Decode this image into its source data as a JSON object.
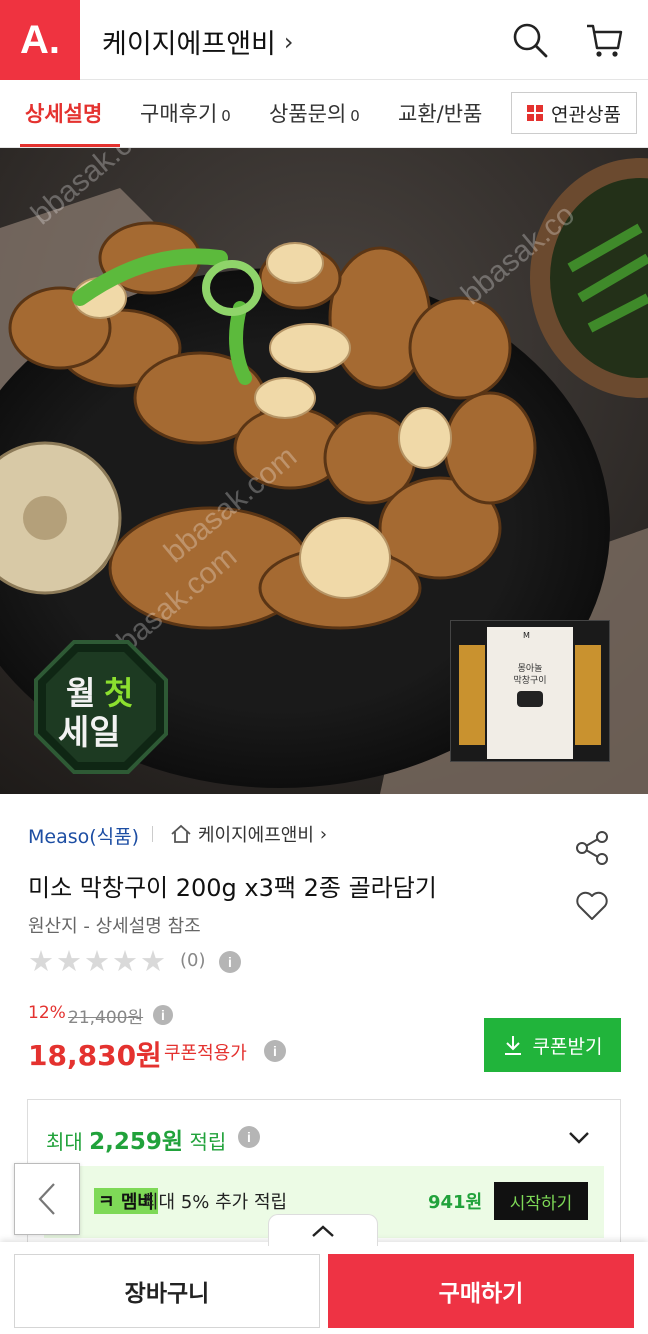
{
  "header": {
    "logo_text": "A.",
    "seller_name": "케이지에프앤비",
    "seller_chevron": "›"
  },
  "tabs": [
    {
      "label": "상세설명",
      "count": "",
      "active": true
    },
    {
      "label": "구매후기",
      "count": "0",
      "active": false
    },
    {
      "label": "상품문의",
      "count": "0",
      "active": false
    },
    {
      "label": "교환/반품",
      "count": "",
      "active": false
    }
  ],
  "related_tab": {
    "label": "연관상품"
  },
  "image": {
    "watermarks": [
      "bbasak.co",
      "bbasak.co",
      "bbasak.com",
      "bbasak.com"
    ],
    "sale_badge": {
      "line1_a": "월",
      "line1_b": "첫",
      "line2": "세일"
    },
    "package": {
      "brand": "M",
      "name_line1": "몽아놀",
      "name_line2": "막창구이"
    }
  },
  "product": {
    "brand": "Measo(식품)",
    "store_name": "케이지에프앤비",
    "store_chevron": "›",
    "title": "미소 막창구이 200g x3팩 2종 골라담기",
    "origin": "원산지 - 상세설명 참조",
    "rating": 0,
    "review_count": "(0)"
  },
  "price": {
    "discount_rate": "12%",
    "original_price": "21,400원",
    "sale_price": "18,830원",
    "coupon_label": "쿠폰적용가",
    "coupon_button": "쿠폰받기"
  },
  "points": {
    "prefix": "최대",
    "amount": "2,259원",
    "suffix": "적립",
    "member_badge_glyph": "ㅋ",
    "member_badge": "멤버",
    "member_desc": "최대 5% 추가 적립",
    "member_points": "941원",
    "member_start": "시작하기"
  },
  "bottom": {
    "cart_label": "장바구니",
    "buy_label": "구매하기"
  },
  "colors": {
    "brand_red": "#ef3340",
    "accent_red": "#e4322f",
    "coupon_green": "#21b43b",
    "points_green": "#21a23b",
    "brand_blue": "#1d4ea3"
  }
}
